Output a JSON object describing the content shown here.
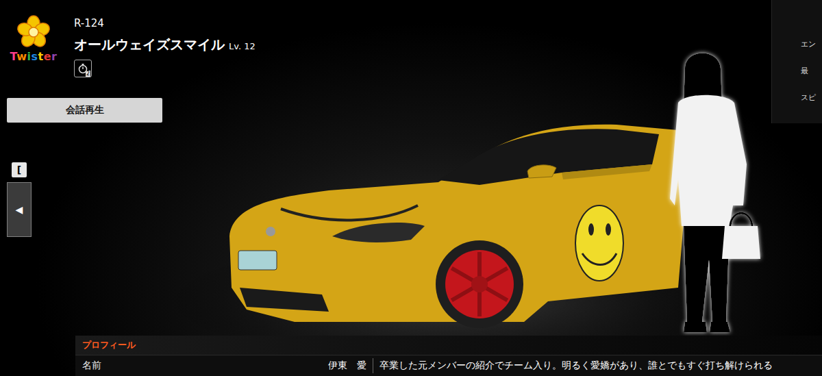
{
  "logo": {
    "text": "Twister"
  },
  "team": {
    "id": "R-124",
    "name": "オールウェイズスマイル",
    "level": "Lv. 12",
    "badge": "2"
  },
  "buttons": [
    {
      "label": "会話再生"
    }
  ],
  "nav": {
    "key_hint": "[",
    "prev": "◀"
  },
  "side_panel": {
    "items": [
      "エン",
      "最",
      "スピ"
    ]
  },
  "profile": {
    "title": "プロフィール",
    "rows": [
      {
        "label": "名前",
        "name": "伊東　愛",
        "description": "卒業した元メンバーの紹介でチーム入り。明るく愛嬌があり、誰とでもすぐ打ち解けられる"
      }
    ]
  }
}
